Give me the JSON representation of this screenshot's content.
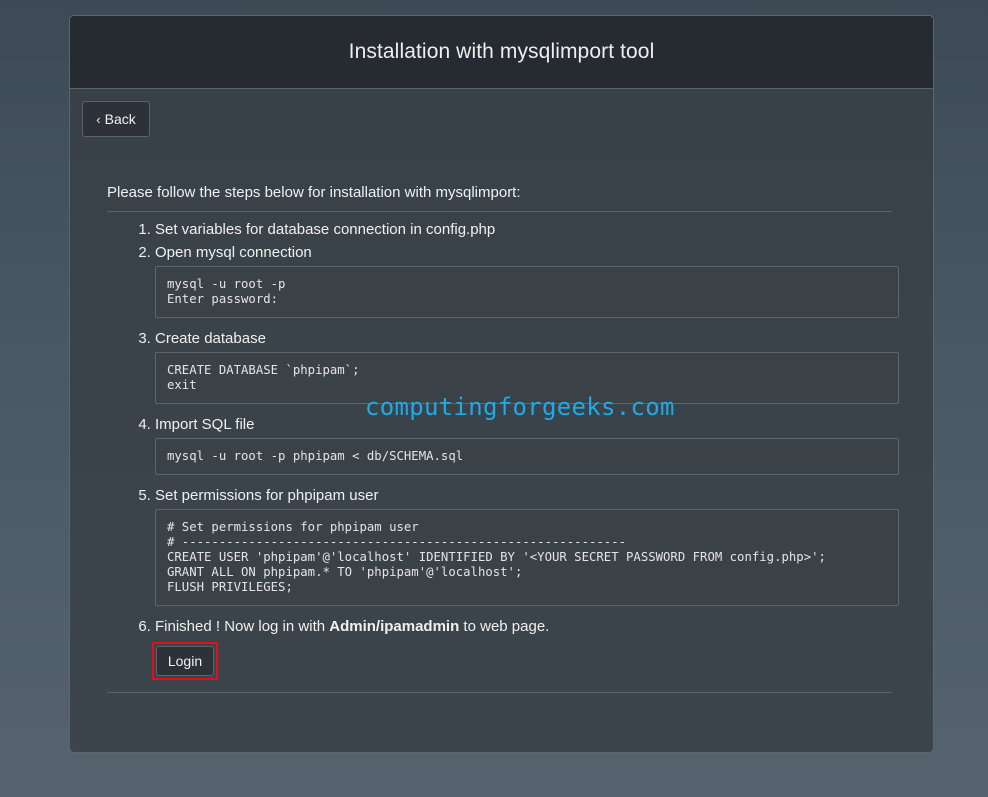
{
  "header": {
    "title": "Installation with mysqlimport tool"
  },
  "back_button": {
    "label": "Back"
  },
  "intro": "Please follow the steps below for installation with mysqlimport:",
  "steps": [
    {
      "text": "Set variables for database connection in config.php"
    },
    {
      "text": "Open mysql connection",
      "code": [
        "mysql -u root -p",
        "Enter password:"
      ]
    },
    {
      "text": "Create database",
      "code": [
        "CREATE DATABASE `phpipam`;",
        "exit"
      ]
    },
    {
      "text": "Import SQL file",
      "code": [
        "mysql -u root -p phpipam < db/SCHEMA.sql"
      ]
    },
    {
      "text": "Set permissions for phpipam user",
      "code": [
        "# Set permissions for phpipam user",
        "# ------------------------------------------------------------",
        "CREATE USER 'phpipam'@'localhost' IDENTIFIED BY '<YOUR SECRET PASSWORD FROM config.php>';",
        "GRANT ALL ON phpipam.* TO 'phpipam'@'localhost';",
        "FLUSH PRIVILEGES;"
      ]
    },
    {
      "text_before": "Finished ! Now log in with ",
      "text_bold": "Admin/ipamadmin",
      "text_after": " to web page."
    }
  ],
  "login_button": {
    "label": "Login"
  },
  "watermark": "computingforgeeks.com",
  "colors": {
    "highlight_border": "#e0101b",
    "watermark": "#1fa9e6"
  }
}
